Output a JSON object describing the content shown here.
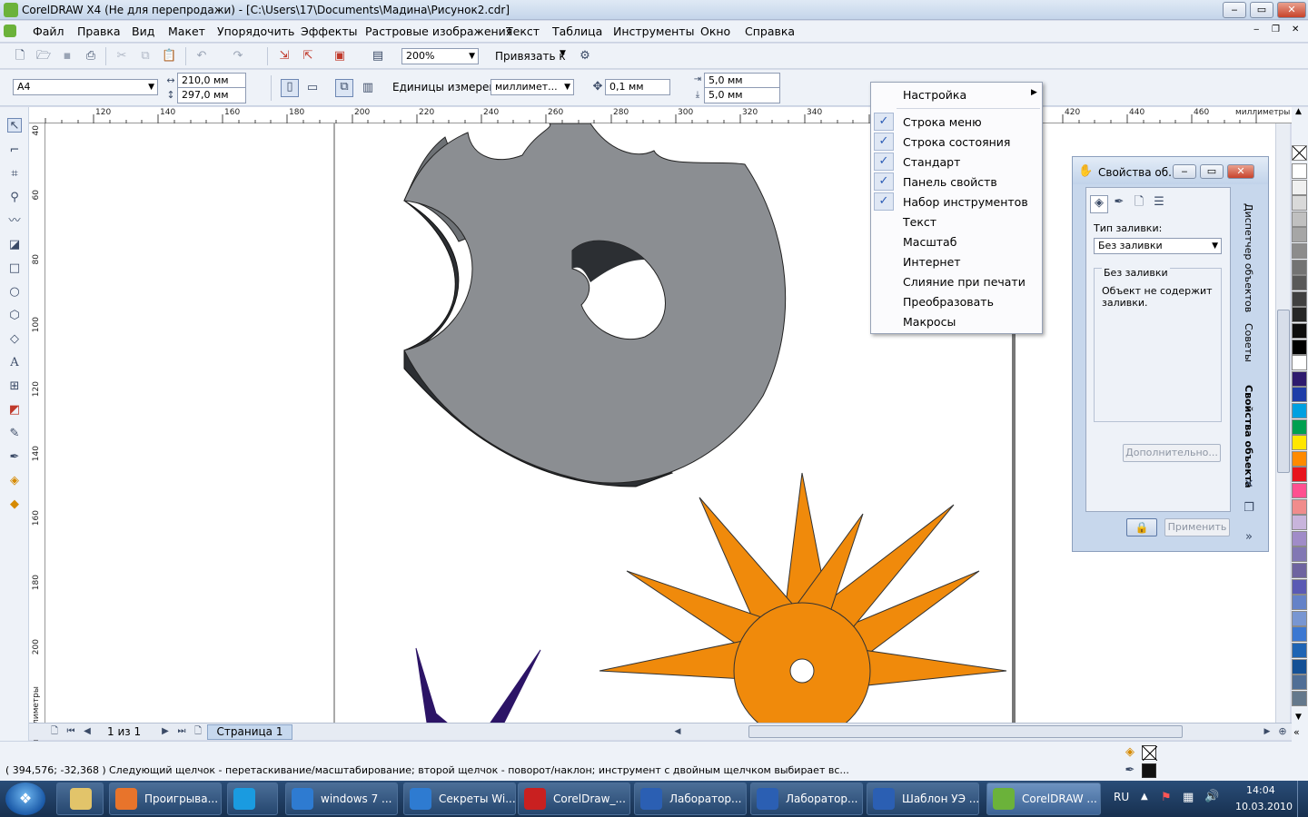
{
  "window": {
    "title": "CorelDRAW X4 (Не для перепродажи) - [C:\\Users\\17\\Documents\\Мадина\\Рисунок2.cdr]",
    "min": "‒",
    "max": "▭",
    "close": "✕"
  },
  "menubar": [
    "Файл",
    "Правка",
    "Вид",
    "Макет",
    "Упорядочить",
    "Эффекты",
    "Растровые изображения",
    "Текст",
    "Таблица",
    "Инструменты",
    "Окно",
    "Справка"
  ],
  "toolbar": {
    "zoom": "200%",
    "snap_label": "Привязать к"
  },
  "properties": {
    "paper": "A4",
    "width": "210,0 мм",
    "height": "297,0 мм",
    "units_label": "Единицы измерения:",
    "units_value": "миллимет...",
    "nudge": "0,1 мм",
    "dup_x": "5,0 мм",
    "dup_y": "5,0 мм"
  },
  "rulers": {
    "h_ticks": [
      "120",
      "140",
      "160",
      "180",
      "200",
      "220",
      "240",
      "260",
      "280",
      "300",
      "320",
      "340",
      "420",
      "440",
      "460"
    ],
    "h_unit": "миллиметры",
    "v_ticks": [
      "40",
      "60",
      "80",
      "100",
      "120",
      "140",
      "160",
      "180",
      "200"
    ],
    "v_unit": "миллиметры"
  },
  "context_menu": {
    "header": "Настройка",
    "items": [
      {
        "label": "Строка меню",
        "checked": true
      },
      {
        "label": "Строка состояния",
        "checked": true
      },
      {
        "label": "Стандарт",
        "checked": true
      },
      {
        "label": "Панель свойств",
        "checked": true
      },
      {
        "label": "Набор инструментов",
        "checked": true
      },
      {
        "label": "Текст",
        "checked": false
      },
      {
        "label": "Масштаб",
        "checked": false
      },
      {
        "label": "Интернет",
        "checked": false
      },
      {
        "label": "Слияние при печати",
        "checked": false
      },
      {
        "label": "Преобразовать",
        "checked": false
      },
      {
        "label": "Макросы",
        "checked": false
      }
    ]
  },
  "docker": {
    "title": "Свойства об...",
    "fill_type_label": "Тип заливки:",
    "fill_type_value": "Без заливки",
    "group_title": "Без заливки",
    "description": "Объект не содержит заливки.",
    "more_button": "Дополнительно...",
    "apply_button": "Применить",
    "tabs": [
      "Диспетчер объектов",
      "Советы",
      "Свойства объекта"
    ]
  },
  "pagebar": {
    "page_count": "1 из 1",
    "page_tab": "Страница 1"
  },
  "status": {
    "coords": "( 394,576; -32,368 )",
    "message": "Следующий щелчок - перетаскивание/масштабирование; второй щелчок - поворот/наклон; инструмент с двойным щелчком выбирает вс..."
  },
  "taskbar": {
    "items": [
      {
        "label": "Проигрыва...",
        "color": "#e8742b"
      },
      {
        "label": "",
        "color": "#1a9be0"
      },
      {
        "label": "windows 7 ...",
        "color": "#2e7bd1"
      },
      {
        "label": "Секреты Wi...",
        "color": "#2e7bd1"
      },
      {
        "label": "CorelDraw_...",
        "color": "#c92020"
      },
      {
        "label": "Лаборатор...",
        "color": "#2b5fb3"
      },
      {
        "label": "Лаборатор...",
        "color": "#2b5fb3"
      },
      {
        "label": "Шаблон УЭ ...",
        "color": "#2b5fb3"
      },
      {
        "label": "CorelDRAW ...",
        "color": "#6bb23a"
      }
    ],
    "lang": "RU",
    "time": "14:04",
    "date": "10.03.2010"
  },
  "palette_colors": [
    "#ffffff",
    "#f0f0f0",
    "#d9d9d9",
    "#c0c0c0",
    "#a6a6a6",
    "#8c8c8c",
    "#737373",
    "#595959",
    "#404040",
    "#262626",
    "#0d0d0d",
    "#000000",
    "#ffffff",
    "#2e1a6e",
    "#1f3da8",
    "#00a0e0",
    "#00a050",
    "#ffe600",
    "#ff8a00",
    "#e8141e",
    "#ff5090",
    "#f08c8c",
    "#c8b4dc",
    "#a08cc8",
    "#8278b4",
    "#6e64a0",
    "#5a5ab4",
    "#6482c8",
    "#7896d2",
    "#3c78d2",
    "#1e64b4",
    "#145096",
    "#506e96",
    "#64788c"
  ]
}
